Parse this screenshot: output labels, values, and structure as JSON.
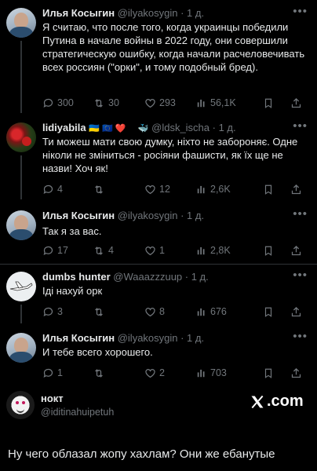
{
  "tweets": [
    {
      "name": "Илья Косыгин",
      "handle": "@ilyakosygin · 1 д.",
      "text": "Я считаю, что после того, когда украинцы победили Путина в начале войны в 2022 году, они совершили стратегическую ошибку, когда начали расчеловечивать всех россиян (\"орки\", и тому подобный бред).",
      "replies": "300",
      "retweets": "30",
      "likes": "293",
      "views": "56,1K"
    },
    {
      "name": "lidiyabila",
      "name_emojis": "🇺🇦 🇪🇺 ❤️ ✌ 🐳",
      "handle": "@ldsk_ischa · 1 д.",
      "text": "Ти можеш мати свою думку, ніхто не забороняє. Одне ніколи не зміниться - росіяни фашисти, як їх ще не назви! Хоч як!",
      "replies": "4",
      "retweets": "",
      "likes": "12",
      "views": "2,6K"
    },
    {
      "name": "Илья Косыгин",
      "handle": "@ilyakosygin · 1 д.",
      "text": "Так я за вас.",
      "replies": "17",
      "retweets": "4",
      "likes": "1",
      "views": "2,8K"
    },
    {
      "name": "dumbs hunter",
      "handle": "@Waaazzzuup · 1 д.",
      "text": "Іді нахуй орк",
      "replies": "3",
      "retweets": "",
      "likes": "8",
      "views": "676"
    },
    {
      "name": "Илья Косыгин",
      "handle": "@ilyakosygin · 1 д.",
      "text": "И тебе всего хорошего.",
      "replies": "1",
      "retweets": "",
      "likes": "2",
      "views": "703"
    }
  ],
  "more_glyph": "•••",
  "card": {
    "name": "нокт",
    "handle": "@iditinahuipetuh",
    "brand": ".com",
    "text": "Ну чего облазал жопу хахлам? Они же ебанутые"
  },
  "colors": {
    "background": "#000000",
    "text": "#e7e9ea",
    "muted": "#71767b",
    "divider": "#2f3336"
  },
  "icons": [
    "reply-icon",
    "retweet-icon",
    "like-icon",
    "views-icon",
    "bookmark-icon",
    "share-icon",
    "more-icon",
    "x-logo-icon"
  ]
}
